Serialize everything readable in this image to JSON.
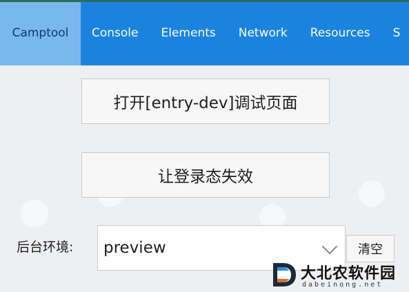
{
  "tabs": [
    {
      "label": "Camptool",
      "active": true
    },
    {
      "label": "Console",
      "active": false
    },
    {
      "label": "Elements",
      "active": false
    },
    {
      "label": "Network",
      "active": false
    },
    {
      "label": "Resources",
      "active": false
    },
    {
      "label": "S",
      "active": false
    }
  ],
  "actions": {
    "open_debug_page": "打开[entry-dev]调试页面",
    "invalidate_login": "让登录态失效"
  },
  "env": {
    "label": "后台环境:",
    "selected": "preview",
    "clear": "清空"
  },
  "watermark": {
    "title": "大北农软件园",
    "subtitle": "dabeinong.net"
  },
  "colors": {
    "tabbar": "#1a83e0",
    "tab_active": "#7ab7ee",
    "background": "#eeeff1"
  }
}
